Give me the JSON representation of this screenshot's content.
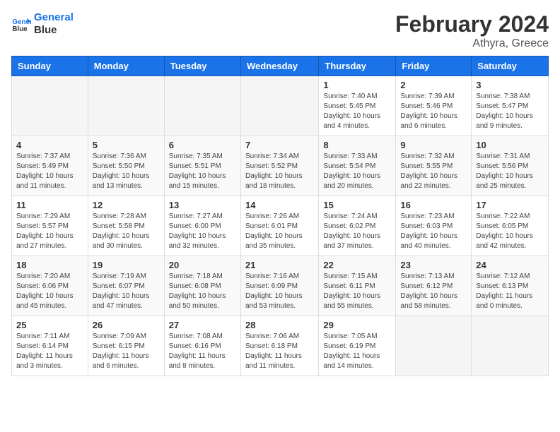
{
  "logo": {
    "line1": "General",
    "line2": "Blue"
  },
  "title": "February 2024",
  "subtitle": "Athyra, Greece",
  "weekdays": [
    "Sunday",
    "Monday",
    "Tuesday",
    "Wednesday",
    "Thursday",
    "Friday",
    "Saturday"
  ],
  "weeks": [
    [
      {
        "day": "",
        "info": ""
      },
      {
        "day": "",
        "info": ""
      },
      {
        "day": "",
        "info": ""
      },
      {
        "day": "",
        "info": ""
      },
      {
        "day": "1",
        "info": "Sunrise: 7:40 AM\nSunset: 5:45 PM\nDaylight: 10 hours\nand 4 minutes."
      },
      {
        "day": "2",
        "info": "Sunrise: 7:39 AM\nSunset: 5:46 PM\nDaylight: 10 hours\nand 6 minutes."
      },
      {
        "day": "3",
        "info": "Sunrise: 7:38 AM\nSunset: 5:47 PM\nDaylight: 10 hours\nand 9 minutes."
      }
    ],
    [
      {
        "day": "4",
        "info": "Sunrise: 7:37 AM\nSunset: 5:49 PM\nDaylight: 10 hours\nand 11 minutes."
      },
      {
        "day": "5",
        "info": "Sunrise: 7:36 AM\nSunset: 5:50 PM\nDaylight: 10 hours\nand 13 minutes."
      },
      {
        "day": "6",
        "info": "Sunrise: 7:35 AM\nSunset: 5:51 PM\nDaylight: 10 hours\nand 15 minutes."
      },
      {
        "day": "7",
        "info": "Sunrise: 7:34 AM\nSunset: 5:52 PM\nDaylight: 10 hours\nand 18 minutes."
      },
      {
        "day": "8",
        "info": "Sunrise: 7:33 AM\nSunset: 5:54 PM\nDaylight: 10 hours\nand 20 minutes."
      },
      {
        "day": "9",
        "info": "Sunrise: 7:32 AM\nSunset: 5:55 PM\nDaylight: 10 hours\nand 22 minutes."
      },
      {
        "day": "10",
        "info": "Sunrise: 7:31 AM\nSunset: 5:56 PM\nDaylight: 10 hours\nand 25 minutes."
      }
    ],
    [
      {
        "day": "11",
        "info": "Sunrise: 7:29 AM\nSunset: 5:57 PM\nDaylight: 10 hours\nand 27 minutes."
      },
      {
        "day": "12",
        "info": "Sunrise: 7:28 AM\nSunset: 5:58 PM\nDaylight: 10 hours\nand 30 minutes."
      },
      {
        "day": "13",
        "info": "Sunrise: 7:27 AM\nSunset: 6:00 PM\nDaylight: 10 hours\nand 32 minutes."
      },
      {
        "day": "14",
        "info": "Sunrise: 7:26 AM\nSunset: 6:01 PM\nDaylight: 10 hours\nand 35 minutes."
      },
      {
        "day": "15",
        "info": "Sunrise: 7:24 AM\nSunset: 6:02 PM\nDaylight: 10 hours\nand 37 minutes."
      },
      {
        "day": "16",
        "info": "Sunrise: 7:23 AM\nSunset: 6:03 PM\nDaylight: 10 hours\nand 40 minutes."
      },
      {
        "day": "17",
        "info": "Sunrise: 7:22 AM\nSunset: 6:05 PM\nDaylight: 10 hours\nand 42 minutes."
      }
    ],
    [
      {
        "day": "18",
        "info": "Sunrise: 7:20 AM\nSunset: 6:06 PM\nDaylight: 10 hours\nand 45 minutes."
      },
      {
        "day": "19",
        "info": "Sunrise: 7:19 AM\nSunset: 6:07 PM\nDaylight: 10 hours\nand 47 minutes."
      },
      {
        "day": "20",
        "info": "Sunrise: 7:18 AM\nSunset: 6:08 PM\nDaylight: 10 hours\nand 50 minutes."
      },
      {
        "day": "21",
        "info": "Sunrise: 7:16 AM\nSunset: 6:09 PM\nDaylight: 10 hours\nand 53 minutes."
      },
      {
        "day": "22",
        "info": "Sunrise: 7:15 AM\nSunset: 6:11 PM\nDaylight: 10 hours\nand 55 minutes."
      },
      {
        "day": "23",
        "info": "Sunrise: 7:13 AM\nSunset: 6:12 PM\nDaylight: 10 hours\nand 58 minutes."
      },
      {
        "day": "24",
        "info": "Sunrise: 7:12 AM\nSunset: 6:13 PM\nDaylight: 11 hours\nand 0 minutes."
      }
    ],
    [
      {
        "day": "25",
        "info": "Sunrise: 7:11 AM\nSunset: 6:14 PM\nDaylight: 11 hours\nand 3 minutes."
      },
      {
        "day": "26",
        "info": "Sunrise: 7:09 AM\nSunset: 6:15 PM\nDaylight: 11 hours\nand 6 minutes."
      },
      {
        "day": "27",
        "info": "Sunrise: 7:08 AM\nSunset: 6:16 PM\nDaylight: 11 hours\nand 8 minutes."
      },
      {
        "day": "28",
        "info": "Sunrise: 7:06 AM\nSunset: 6:18 PM\nDaylight: 11 hours\nand 11 minutes."
      },
      {
        "day": "29",
        "info": "Sunrise: 7:05 AM\nSunset: 6:19 PM\nDaylight: 11 hours\nand 14 minutes."
      },
      {
        "day": "",
        "info": ""
      },
      {
        "day": "",
        "info": ""
      }
    ]
  ]
}
